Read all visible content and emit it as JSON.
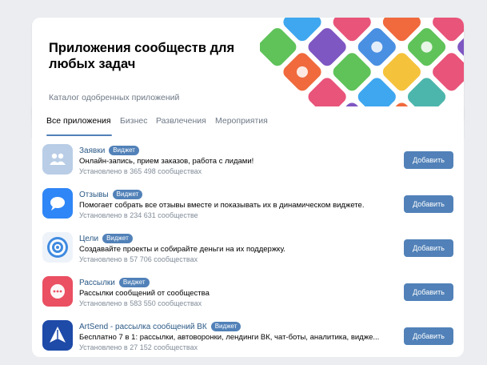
{
  "header": {
    "title": "Приложения сообществ для любых задач",
    "subtitle": "Каталог одобренных приложений"
  },
  "tabs": [
    {
      "label": "Все приложения",
      "active": true
    },
    {
      "label": "Бизнес",
      "active": false
    },
    {
      "label": "Развлечения",
      "active": false
    },
    {
      "label": "Мероприятия",
      "active": false
    }
  ],
  "apps": [
    {
      "name": "Заявки",
      "badge": "Виджет",
      "description": "Онлайн-запись, прием заказов, работа с лидами!",
      "installs": "Установлено в 365 498 сообществах",
      "button": "Добавить",
      "icon": "people-icon",
      "color": "#b9cde6"
    },
    {
      "name": "Отзывы",
      "badge": "Виджет",
      "description": "Помогает собрать все отзывы вместе и показывать их в динамическом виджете.",
      "installs": "Установлено в 234 631 сообществе",
      "button": "Добавить",
      "icon": "chat-bubble-icon",
      "color": "#2f86f6"
    },
    {
      "name": "Цели",
      "badge": "Виджет",
      "description": "Создавайте проекты и собирайте деньги на их поддержку.",
      "installs": "Установлено в 57 706 сообществах",
      "button": "Добавить",
      "icon": "target-icon",
      "color": "#eef3fa"
    },
    {
      "name": "Рассылки",
      "badge": "Виджет",
      "description": "Рассылки сообщений от сообщества",
      "installs": "Установлено в 583 550 сообществах",
      "button": "Добавить",
      "icon": "message-dots-icon",
      "color": "#ea4f62"
    },
    {
      "name": "ArtSend - рассылка сообщений ВК",
      "badge": "Виджет",
      "description": "Бесплатно 7 в 1: рассылки, автоворонки, лендинги ВК, чат-боты, аналитика, видже...",
      "installs": "Установлено в 27 152 сообществах",
      "button": "Добавить",
      "icon": "artsend-logo-icon",
      "color": "#1e4aa8"
    }
  ],
  "colors": {
    "accent": "#5181b8",
    "link": "#2a5885",
    "muted": "#818c99",
    "background": "#ebedf0"
  }
}
